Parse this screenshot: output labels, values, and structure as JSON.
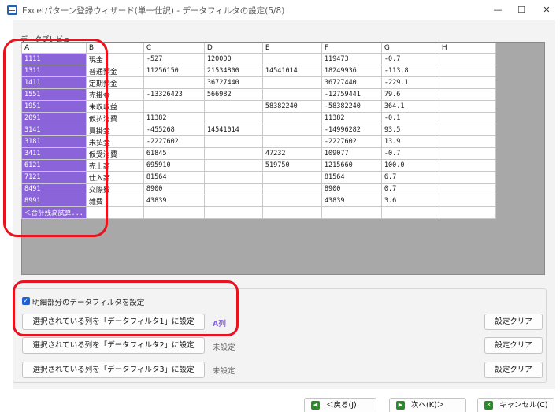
{
  "window": {
    "title": "Excelパターン登録ウィザード(単一仕訳) - データフィルタの設定(5/8)",
    "minimize": "—",
    "maximize": "☐",
    "close": "✕"
  },
  "preview": {
    "label": "データプレビュー",
    "columns": [
      "A",
      "B",
      "C",
      "D",
      "E",
      "F",
      "G",
      "H"
    ],
    "rows": [
      [
        "1111",
        "現金",
        "-527",
        "120000",
        "",
        "119473",
        "-0.7",
        ""
      ],
      [
        "1311",
        "普通預金",
        "11256150",
        "21534800",
        "14541014",
        "18249936",
        "-113.8",
        ""
      ],
      [
        "1411",
        "定期預金",
        "",
        "36727440",
        "",
        "36727440",
        "-229.1",
        ""
      ],
      [
        "1551",
        "売掛金",
        "-13326423",
        "566982",
        "",
        "-12759441",
        "79.6",
        ""
      ],
      [
        "1951",
        "未収収益",
        "",
        "",
        "58382240",
        "-58382240",
        "364.1",
        ""
      ],
      [
        "2091",
        "仮払消費",
        "11382",
        "",
        "",
        "11382",
        "-0.1",
        ""
      ],
      [
        "3141",
        "買掛金",
        "-455268",
        "14541014",
        "",
        "-14996282",
        "93.5",
        ""
      ],
      [
        "3181",
        "未払金",
        "-2227602",
        "",
        "",
        "-2227602",
        "13.9",
        ""
      ],
      [
        "3411",
        "仮受消費",
        "61845",
        "",
        "47232",
        "109077",
        "-0.7",
        ""
      ],
      [
        "6121",
        "売上高",
        "695910",
        "",
        "519750",
        "1215660",
        "100.0",
        ""
      ],
      [
        "7121",
        "仕入高",
        "81564",
        "",
        "",
        "81564",
        "6.7",
        ""
      ],
      [
        "8491",
        "交際費",
        "8900",
        "",
        "",
        "8900",
        "0.7",
        ""
      ],
      [
        "8991",
        "雑費",
        "43839",
        "",
        "",
        "43839",
        "3.6",
        ""
      ],
      [
        "＜合計残高試算...",
        "",
        "",
        "",
        "",
        "",
        "",
        ""
      ]
    ]
  },
  "filters": {
    "enable_label": "明細部分のデータフィルタを設定",
    "enabled": true,
    "items": [
      {
        "button": "選択されている列を「データフィルタ1」に設定",
        "status": "A列",
        "status_color": "#8a64d8",
        "clear": "設定クリア"
      },
      {
        "button": "選択されている列を「データフィルタ2」に設定",
        "status": "未設定",
        "status_color": "#666666",
        "clear": "設定クリア"
      },
      {
        "button": "選択されている列を「データフィルタ3」に設定",
        "status": "未設定",
        "status_color": "#666666",
        "clear": "設定クリア"
      }
    ]
  },
  "footer": {
    "back": "＜戻る(J)",
    "next": "次へ(K)＞",
    "cancel": "キャンセル(C)"
  }
}
